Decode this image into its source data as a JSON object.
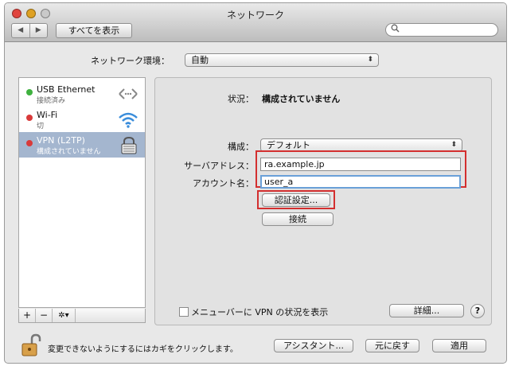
{
  "window": {
    "title": "ネットワーク"
  },
  "toolbar": {
    "back": "◀",
    "forward": "▶",
    "show_all": "すべてを表示",
    "search_placeholder": ""
  },
  "location": {
    "label": "ネットワーク環境：",
    "value": "自動"
  },
  "services": [
    {
      "name": "USB Ethernet",
      "status": "接続済み",
      "dot_color": "#3fb13f",
      "icon": "ethernet-arrows-icon"
    },
    {
      "name": "Wi-Fi",
      "status": "切",
      "dot_color": "#d93a3a",
      "icon": "wifi-icon"
    },
    {
      "name": "VPN (L2TP)",
      "status": "構成されていません",
      "dot_color": "#d93a3a",
      "icon": "vpn-lock-icon",
      "selected": true
    }
  ],
  "sidebar_tools": {
    "add": "+",
    "remove": "−",
    "gear": "✲▾"
  },
  "detail": {
    "status_label": "状況：",
    "status_value": "構成されていません",
    "config_label": "構成：",
    "config_value": "デフォルト",
    "server_label": "サーバアドレス：",
    "server_value": "ra.example.jp",
    "account_label": "アカウント名：",
    "account_value": "user_a",
    "auth_button": "認証設定...",
    "connect_button": "接続"
  },
  "menubar_checkbox": {
    "label": "メニューバーに VPN の状況を表示",
    "checked": false
  },
  "advanced_button": "詳細...",
  "help_button": "?",
  "footer": {
    "lock_text": "変更できないようにするにはカギをクリックします。",
    "assistant": "アシスタント...",
    "revert": "元に戻す",
    "apply": "適用"
  },
  "colors": {
    "highlight": "#d32f2f",
    "selection": "#a4b6cf",
    "focus": "#6aa0d8"
  }
}
